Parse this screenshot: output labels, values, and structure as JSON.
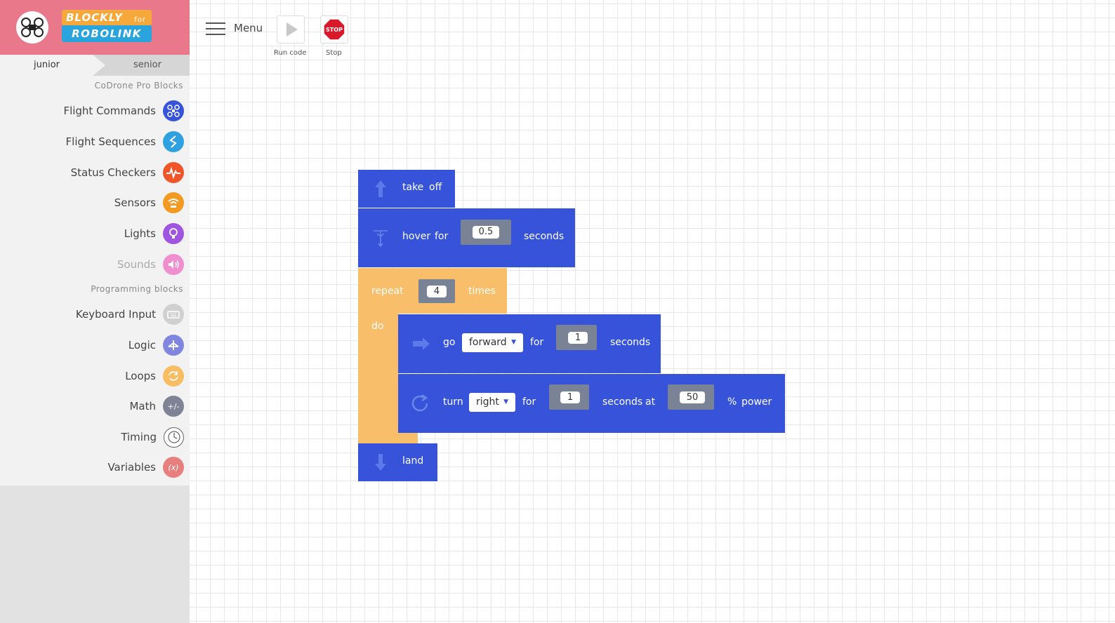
{
  "brand": {
    "line1": "BLOCKLY",
    "for": "for",
    "line2": "ROBOLINK"
  },
  "tabs": {
    "junior": "junior",
    "senior": "senior"
  },
  "palette": {
    "section1": "CoDrone Pro Blocks",
    "section2": "Programming blocks",
    "categories": [
      {
        "label": "Flight Commands",
        "color": "#3653d9",
        "icon": "drone-icon"
      },
      {
        "label": "Flight Sequences",
        "color": "#2fa0e0",
        "icon": "zigzag-icon"
      },
      {
        "label": "Status Checkers",
        "color": "#f0552a",
        "icon": "pulse-icon"
      },
      {
        "label": "Sensors",
        "color": "#f29a22",
        "icon": "sensor-icon"
      },
      {
        "label": "Lights",
        "color": "#a055e0",
        "icon": "lightbulb-icon"
      },
      {
        "label": "Sounds",
        "color": "#ef8fd0",
        "icon": "speaker-icon"
      },
      {
        "label": "Keyboard Input",
        "color": "#d0d0d0",
        "icon": "keyboard-icon"
      },
      {
        "label": "Logic",
        "color": "#8086e0",
        "icon": "logic-icon"
      },
      {
        "label": "Loops",
        "color": "#f8bc62",
        "icon": "loop-icon"
      },
      {
        "label": "Math",
        "color": "#7f8396",
        "icon": "math-icon",
        "glyph": "+/-"
      },
      {
        "label": "Timing",
        "color": "#ffffff",
        "icon": "clock-icon"
      },
      {
        "label": "Variables",
        "color": "#e77f7f",
        "icon": "variable-icon",
        "glyph": "(x)"
      }
    ]
  },
  "toolbar": {
    "menu": "Menu",
    "run": "Run code",
    "stop": "Stop",
    "stop_sign": "STOP"
  },
  "blocks": {
    "takeoff": {
      "w1": "take",
      "w2": "off"
    },
    "hover": {
      "w1": "hover",
      "w2": "for",
      "value": "0.5",
      "w3": "seconds"
    },
    "repeat": {
      "w1": "repeat",
      "value": "4",
      "w2": "times",
      "do": "do"
    },
    "go": {
      "w1": "go",
      "direction": "forward",
      "w2": "for",
      "value": "1",
      "w3": "seconds"
    },
    "turn": {
      "w1": "turn",
      "direction": "right",
      "w2": "for",
      "value": "1",
      "w3": "seconds",
      "w4": "at",
      "power": "50",
      "w5": "%",
      "w6": "power"
    },
    "land": {
      "w1": "land"
    }
  }
}
